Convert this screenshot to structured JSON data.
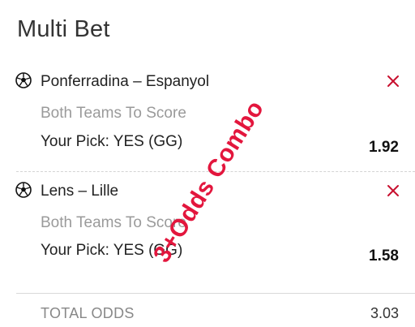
{
  "header": {
    "title": "Multi Bet"
  },
  "bets": [
    {
      "match": "Ponferradina – Espanyol",
      "market": "Both Teams To Score",
      "pick": "Your Pick: YES (GG)",
      "odds": "1.92",
      "icon": "soccer-ball-icon"
    },
    {
      "match": "Lens – Lille",
      "market": "Both Teams To Score",
      "pick": "Your Pick: YES (GG)",
      "odds": "1.58",
      "icon": "soccer-ball-icon"
    }
  ],
  "total": {
    "label": "TOTAL ODDS",
    "value": "3.03"
  },
  "watermark": {
    "text": "3+Odds Combo",
    "color": "#e3163d"
  },
  "colors": {
    "remove_icon": "#c8102e",
    "muted_text": "#9a9a9a"
  }
}
